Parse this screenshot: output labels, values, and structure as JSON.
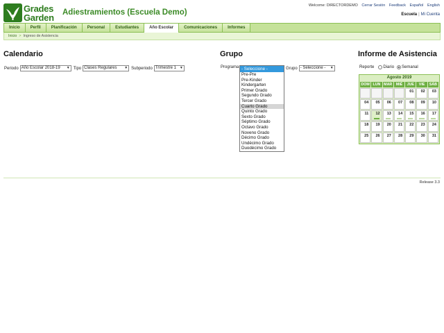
{
  "logo": {
    "line1": "Grades",
    "line2": "Garden"
  },
  "school_title": "Adiestramientos (Escuela Demo)",
  "toplinks": {
    "welcome": "Welcome: DIRECTORDEMO",
    "logout": "Cerrar Sesión",
    "feedback": "Feedback",
    "lang_es": "Español",
    "lang_en": "English"
  },
  "schoolnav": {
    "current": "Escuela",
    "sep": "|",
    "mine": "Mi Cuenta"
  },
  "menu": {
    "tabs": [
      {
        "label": "Inicio"
      },
      {
        "label": "Perfil"
      },
      {
        "label": "Planificación"
      },
      {
        "label": "Personal"
      },
      {
        "label": "Estudiantes"
      },
      {
        "label": "Año Escolar"
      },
      {
        "label": "Comunicaciones"
      },
      {
        "label": "Informes"
      }
    ]
  },
  "breadcrumb": {
    "home": "Inicio",
    "sep": ">",
    "current": "Ingreso de Asistencia"
  },
  "calendario": {
    "title": "Calendario",
    "periodo_label": "Periodo",
    "periodo_value": "Año Escolar 2018-19",
    "tipo_label": "Tipo",
    "tipo_value": "Clases Regulares",
    "subperiodo_label": "Subperiodo",
    "subperiodo_value": "Trimestre 1"
  },
  "grupo": {
    "title": "Grupo",
    "programa_label": "Programa",
    "grupo_label": "Grupo",
    "grupo_value": "- Seleccione -",
    "dropdown_selected": "- Seleccione -",
    "options": [
      "Pre-Pre",
      "Pre-Kinder",
      "Kindergarten",
      "Primer Grado",
      "Segundo Grado",
      "Tercer Grado",
      "Cuarto Grado",
      "Quinto Grado",
      "Sexto Grado",
      "Séptimo Grado",
      "Octavo Grado",
      "Noveno Grado",
      "Décimo Grado",
      "Undécimo Grado",
      "Duodécimo Grado"
    ],
    "hovered_option": "Cuarto Grado"
  },
  "informe": {
    "title": "Informe de Asistencia",
    "reporte_label": "Reporte",
    "diario_label": "Diario",
    "semanal_label": "Semanal",
    "selected": "Semanal"
  },
  "calendar": {
    "month": "Agosto 2019",
    "dows": [
      "DOM",
      "LUN",
      "MAR",
      "MIÉ",
      "JUE",
      "VIE",
      "SÁB"
    ],
    "weeks": [
      [
        "",
        "",
        "",
        "",
        "01",
        "02",
        "03"
      ],
      [
        "04",
        "05",
        "06",
        "07",
        "08",
        "09",
        "10"
      ],
      [
        "11",
        "12",
        "13",
        "14",
        "15",
        "16",
        "17"
      ],
      [
        "18",
        "19",
        "20",
        "21",
        "22",
        "23",
        "24"
      ],
      [
        "25",
        "26",
        "27",
        "28",
        "29",
        "30",
        "31"
      ]
    ],
    "today": "12",
    "accent": "#6fb043"
  },
  "footer": {
    "release": "Release 3.3"
  }
}
